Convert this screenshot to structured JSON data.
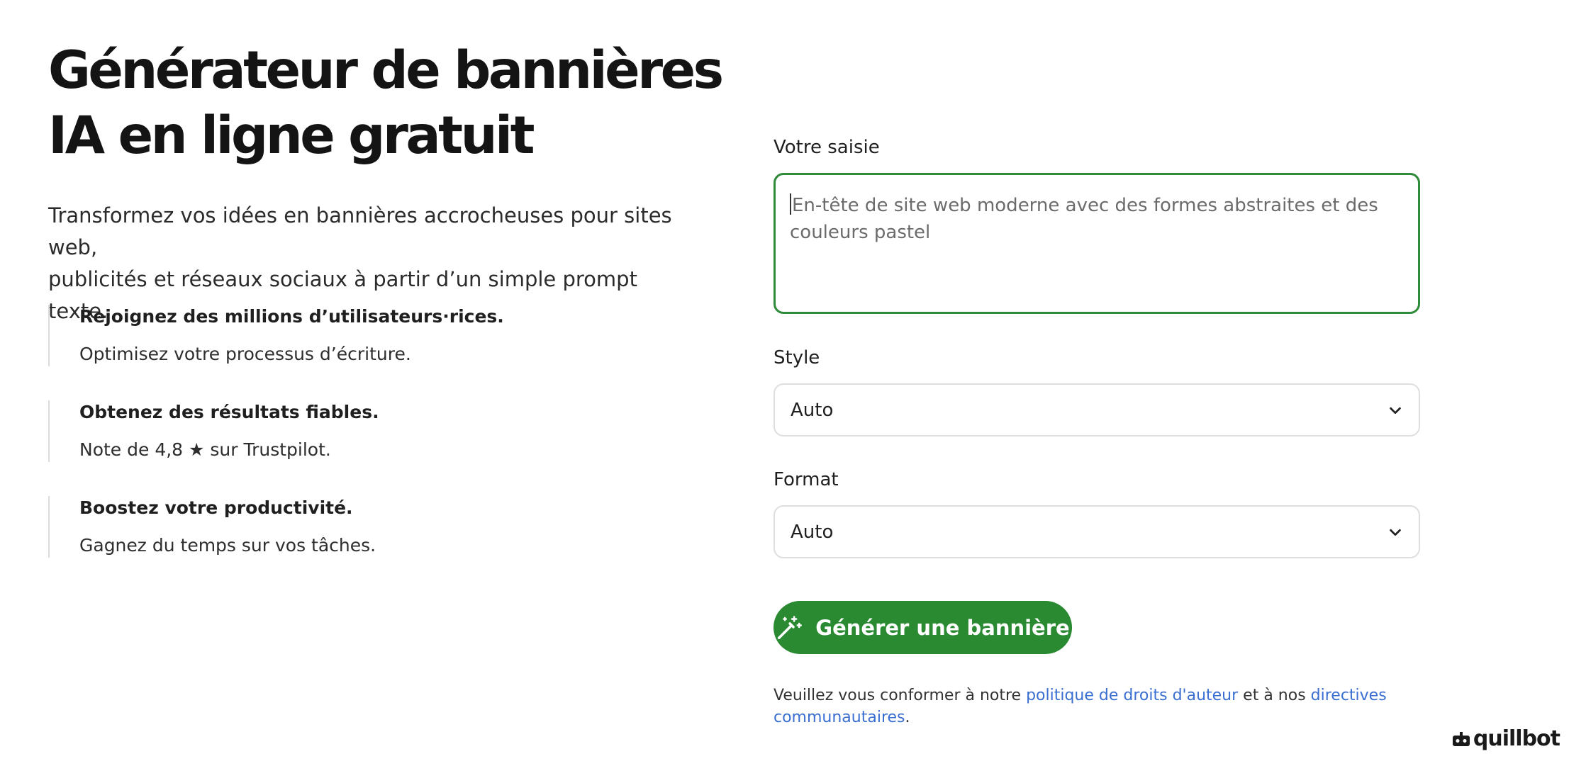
{
  "hero": {
    "title_line1": "Générateur de bannières",
    "title_line2": "IA en ligne gratuit",
    "subtitle_line1": "Transformez vos idées en bannières accrocheuses pour sites web,",
    "subtitle_line2": "publicités et réseaux sociaux à partir d’un simple prompt texte."
  },
  "features": [
    {
      "title": "Rejoignez des millions d’utilisateurs·rices.",
      "desc": "Optimisez votre processus d’écriture."
    },
    {
      "title": "Obtenez des résultats fiables.",
      "desc": "Note de 4,8 ★ sur Trustpilot."
    },
    {
      "title": "Boostez votre productivité.",
      "desc": "Gagnez du temps sur vos tâches."
    }
  ],
  "form": {
    "input_label": "Votre saisie",
    "input_placeholder": "En-tête de site web moderne avec des formes abstraites et des couleurs pastel",
    "style_label": "Style",
    "style_value": "Auto",
    "format_label": "Format",
    "format_value": "Auto",
    "generate_label": "Générer une bannière"
  },
  "terms": {
    "prefix": "Veuillez vous conformer à notre ",
    "link1": "politique de droits d'auteur",
    "middle": " et à nos ",
    "link2": "directives communautaires",
    "suffix": "."
  },
  "brand": {
    "logo_text": "quillbot",
    "accent_color": "#2a8a32",
    "link_color": "#3a6fd1"
  }
}
